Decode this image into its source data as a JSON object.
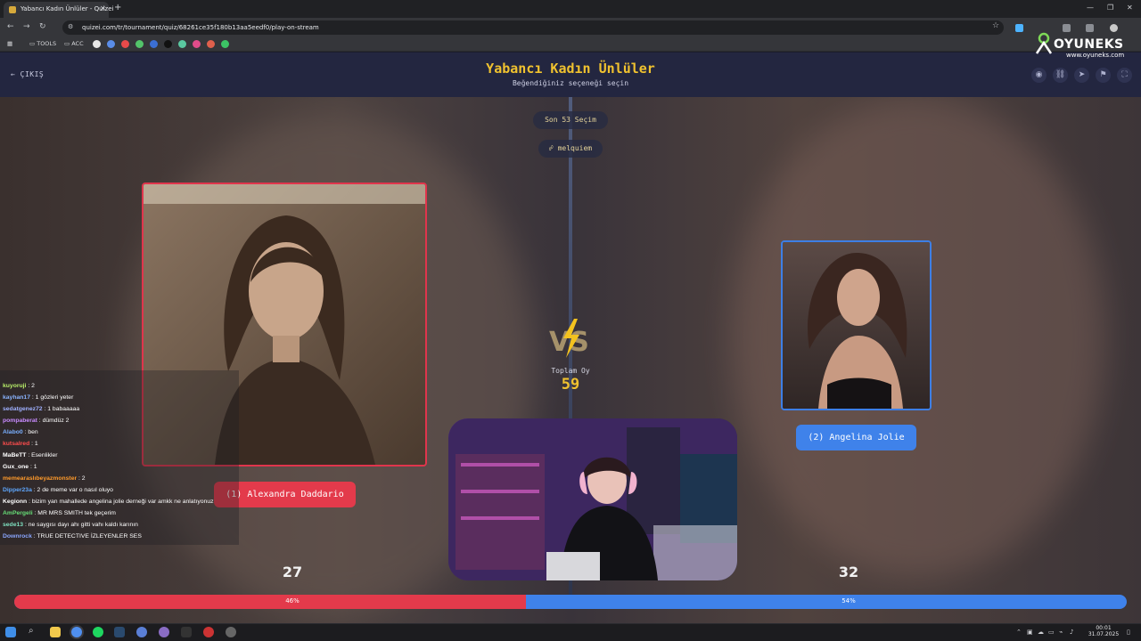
{
  "browser": {
    "tab_title": "Yabancı Kadın Ünlüler - Quizei",
    "url": "quizei.com/tr/tournament/quiz/68261ce35f180b13aa5eedf0/play-on-stream",
    "bookmarks": [
      "TOOLS",
      "ACC"
    ]
  },
  "overlay": {
    "brand": "OYUNEKS",
    "site": "www.oyuneks.com"
  },
  "header": {
    "exit_label": "ÇIKIŞ",
    "title": "Yabancı Kadın Ünlüler",
    "subtitle": "Beğendiğiniz seçeneği seçin"
  },
  "stage": {
    "last_choices": "Son 53 Seçim",
    "user": "melquiem",
    "total_label": "Toplam Oy",
    "total_votes": "59"
  },
  "options": {
    "left": {
      "name": "(1) Alexandra Daddario",
      "votes": "27",
      "percent_label": "46%",
      "percent": 46
    },
    "right": {
      "name": "(2) Angelina Jolie",
      "votes": "32",
      "percent_label": "54%",
      "percent": 54
    }
  },
  "colors": {
    "accent": "#f0c22f",
    "left": "#e33a4b",
    "right": "#3f82ea"
  },
  "chat": [
    {
      "user": "kuyoruji",
      "text": ": 2",
      "color": "#b9f06a"
    },
    {
      "user": "kayhan17",
      "text": ": 1 gözleri yeter",
      "color": "#8ab4ff"
    },
    {
      "user": "sedatgenez72",
      "text": ": 1 babaaaaa",
      "color": "#9fb0ff"
    },
    {
      "user": "pompaberat",
      "text": ": dümdüz 2",
      "color": "#c88bff"
    },
    {
      "user": "Alabo0",
      "text": ": ben",
      "color": "#7ab0ff"
    },
    {
      "user": "kutsalred",
      "text": ": 1",
      "color": "#ff4d4d"
    },
    {
      "user": "MaBeTT",
      "text": ": Esenlikler",
      "color": "#ffffff"
    },
    {
      "user": "Gux_one",
      "text": ": 1",
      "color": "#ffffff"
    },
    {
      "user": "memearaslıbeyazmonster",
      "text": ": 2",
      "color": "#ff9a2a"
    },
    {
      "user": "Dipper23a",
      "text": ": 2 de meme var o nasıl oluyo",
      "color": "#5fa8ff"
    },
    {
      "user": "Kegionn",
      "text": ": bizim yan mahallede angelina jolie derneği var amkk ne anlatıyonuz",
      "color": "#ffffff"
    },
    {
      "user": "AmPergeli",
      "text": ": MR MRS SMITH tek geçerim",
      "color": "#66dd77"
    },
    {
      "user": "sede13",
      "text": ": ne saygısı dayı ahı gitti vahı kaldı karının",
      "color": "#7fe0c0"
    },
    {
      "user": "Downrock",
      "text": ": TRUE DETECTIVE İZLEYENLER SES",
      "color": "#8aa6ff"
    }
  ],
  "taskbar": {
    "time": "00:01",
    "date": "31.07.2025"
  }
}
